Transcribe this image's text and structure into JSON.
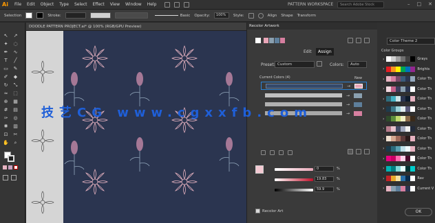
{
  "menubar": {
    "logo": "Ai",
    "items": [
      "File",
      "Edit",
      "Object",
      "Type",
      "Select",
      "Effect",
      "View",
      "Window",
      "Help"
    ],
    "workspace": "PATTERN WORKSPACE",
    "search_placeholder": "Search Adobe Stock"
  },
  "controlbar": {
    "selection": "Selection",
    "stroke_label": "Stroke:",
    "stroke_style": "Basic",
    "opacity_label": "Opacity:",
    "opacity_value": "100%",
    "style_label": "Style:",
    "align_label": "Align",
    "shape_label": "Shape",
    "transform_label": "Transform"
  },
  "document": {
    "tab_title": "DOODLE PATTERN PROJECT.ai* @ 100% (RGB/GPU Preview)"
  },
  "dialog": {
    "title": "Recolor Artwork",
    "tabs": [
      "Edit",
      "Assign"
    ],
    "active_tab": "Assign",
    "preset_label": "Preset:",
    "preset_value": "Custom",
    "colors_label": "Colors:",
    "colors_value": "Auto",
    "current_colors_label": "Current Colors (4)",
    "new_label": "New",
    "hex_values": [
      "0",
      "19.83",
      "59.9"
    ],
    "percent": "%",
    "recolor_art_label": "Recolor Art",
    "ok_label": "OK",
    "colors": {
      "accent": "#2a83d8",
      "row_colors": [
        "#e9a6b7",
        "#8aa0b0",
        "#5e7f9c",
        "#d67fa0"
      ]
    }
  },
  "color_groups": {
    "title": "Color Theme 2",
    "header": "Color Groups",
    "items": [
      {
        "label": "Grays",
        "colors": [
          "#ffffff",
          "#d0d0d0",
          "#a0a0a0",
          "#707070",
          "#404040",
          "#000000"
        ]
      },
      {
        "label": "Brights",
        "colors": [
          "#e31e24",
          "#f7941d",
          "#fff200",
          "#00a651",
          "#0072bc",
          "#92278f"
        ]
      },
      {
        "label": "Color Th",
        "colors": [
          "#e7b3c1",
          "#d67fa0",
          "#7a4a6a",
          "#3a5a7a",
          "#2b3550",
          "#94a9bd"
        ]
      },
      {
        "label": "Color Th",
        "colors": [
          "#f4d9e0",
          "#c6608a",
          "#3f3f5f",
          "#8aa0b0",
          "#2b3550",
          "#ffffff"
        ]
      },
      {
        "label": "Color Th",
        "colors": [
          "#2f6e7e",
          "#44b0c2",
          "#cde4e8",
          "#2b3550",
          "#0d1a2a",
          "#e7b3c1"
        ]
      },
      {
        "label": "Color Th",
        "colors": [
          "#1f3b4b",
          "#3e7a8a",
          "#9bd1d9",
          "#e2edf0",
          "#5a5a7a",
          "#ffffff"
        ]
      },
      {
        "label": "Color Th",
        "colors": [
          "#2e4a2a",
          "#5c8c3a",
          "#c1d96d",
          "#f2f0c4",
          "#8a6a4a",
          "#3a2a1a"
        ]
      },
      {
        "label": "Color Th",
        "colors": [
          "#b77c8c",
          "#e8c2cc",
          "#444c66",
          "#a2aabf",
          "#f0f0f0",
          "#222a3a"
        ]
      },
      {
        "label": "Color Th",
        "colors": [
          "#f0e0d0",
          "#d5a890",
          "#a06a5a",
          "#5c3a3a",
          "#2a1a1a",
          "#e7b3c1"
        ]
      },
      {
        "label": "Color Th",
        "colors": [
          "#1a3a4a",
          "#2a6a7a",
          "#5aa0b0",
          "#c0e0e8",
          "#f0f8fa",
          "#e7b3c1"
        ]
      },
      {
        "label": "Color Th",
        "colors": [
          "#e6007e",
          "#c80064",
          "#ff6ab0",
          "#ffd0e8",
          "#4a0a2a",
          "#ffffff"
        ]
      },
      {
        "label": "Color Th",
        "colors": [
          "#00b3b3",
          "#008080",
          "#7fd9d9",
          "#e6ffff",
          "#003333",
          "#00cccc"
        ]
      },
      {
        "label": "Rav",
        "colors": [
          "#c12127",
          "#e8a92a",
          "#f6e1a1",
          "#2a6fa8",
          "#0a2a4a",
          "#ffffff"
        ]
      },
      {
        "label": "Current V",
        "colors": [
          "#e7b3c1",
          "#8aa0b0",
          "#5e7f9c",
          "#d67fa0",
          "#2b3550",
          "#ffffff"
        ]
      }
    ]
  },
  "watermark": "技艺CG www.cgxxfb.com"
}
